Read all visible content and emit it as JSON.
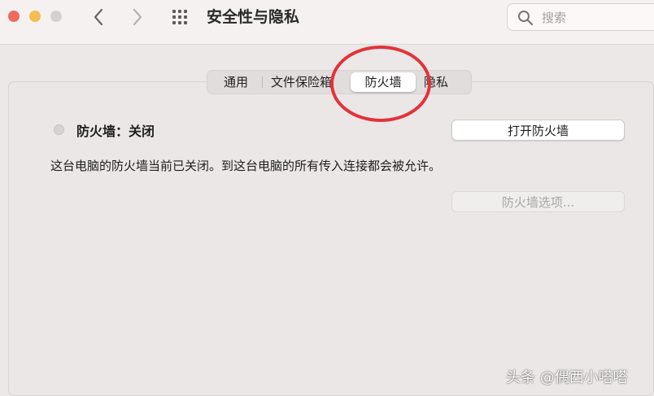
{
  "window": {
    "title": "安全性与隐私"
  },
  "toolbar": {
    "back_icon": "chevron-left-icon",
    "forward_icon": "chevron-right-icon",
    "grid_icon": "grid-icon"
  },
  "search": {
    "placeholder": "搜索",
    "value": ""
  },
  "tabs": [
    {
      "label": "通用",
      "selected": false
    },
    {
      "label": "文件保险箱",
      "selected": false
    },
    {
      "label": "防火墙",
      "selected": true
    },
    {
      "label": "隐私",
      "selected": false
    }
  ],
  "firewall": {
    "status_label": "防火墙：关闭",
    "description": "这台电脑的防火墙当前已关闭。到这台电脑的所有传入连接都会被允许。",
    "turn_on_button": "打开防火墙",
    "options_button": "防火墙选项...",
    "options_enabled": false
  },
  "watermark": "头条 @偶西小嗒嗒",
  "colors": {
    "annotation": "#e2333a",
    "close": "#ee6a5f",
    "minimize": "#f5be4f"
  }
}
